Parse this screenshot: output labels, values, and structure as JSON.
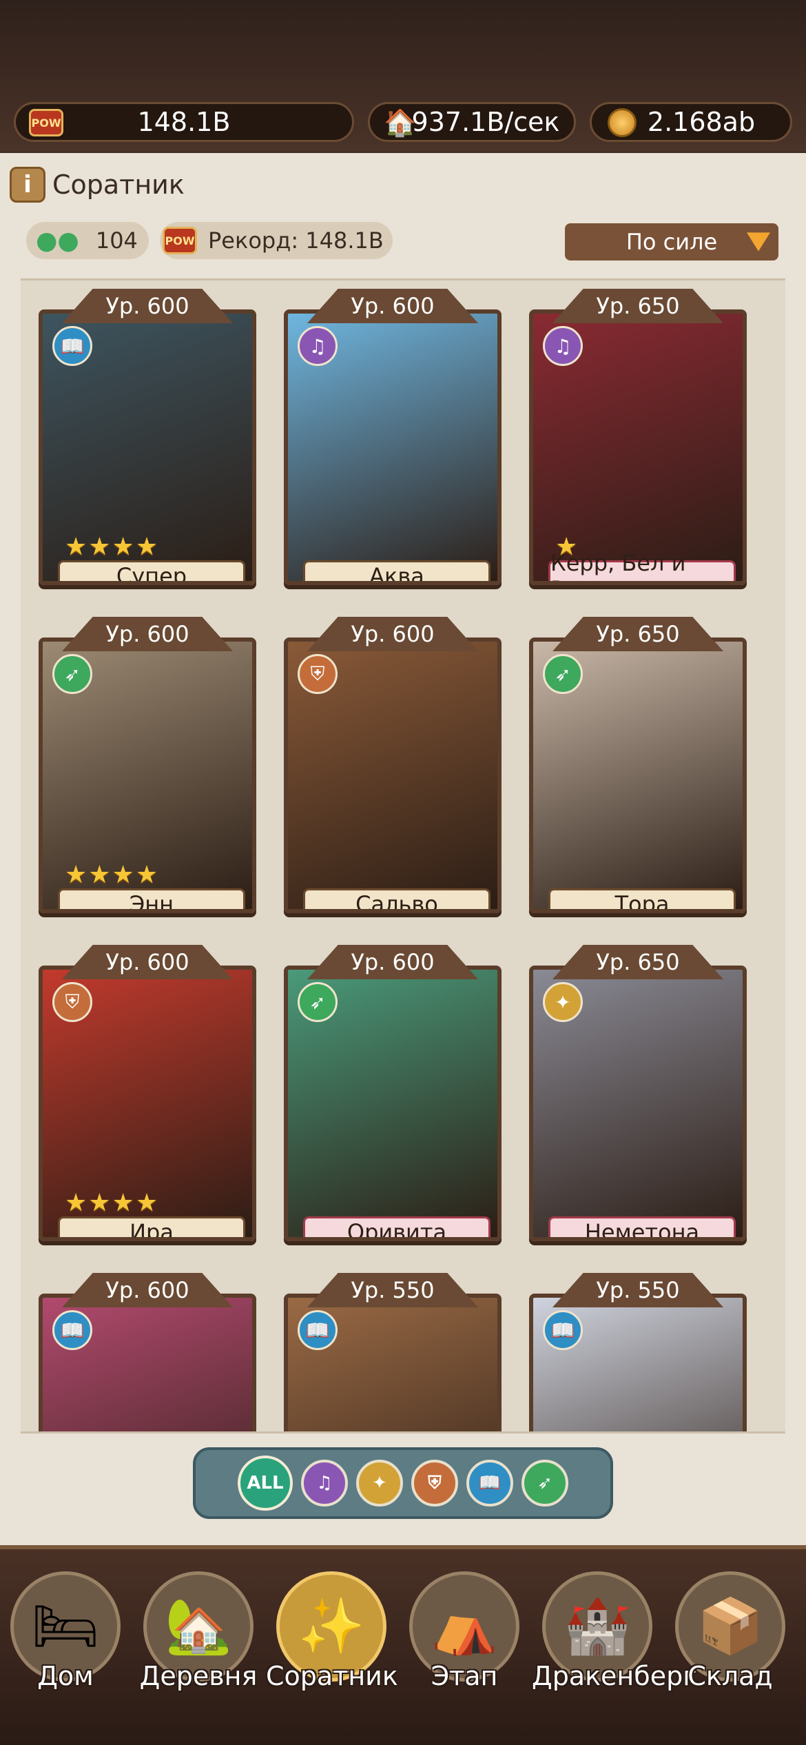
{
  "topbar": {
    "pow_icon": "POW",
    "power": "148.1B",
    "income": "937.1B/сек",
    "currency": "2.168ab"
  },
  "header": {
    "title": "Соратник"
  },
  "stats": {
    "count": "104",
    "pow_icon": "POW",
    "record": "Рекорд: 148.1B",
    "sort": "По силе"
  },
  "cards": [
    {
      "level": "Ур. 600",
      "name": "Супер",
      "stars": "★★★★",
      "role_icon": "book-icon",
      "role_color": "#2f8fc4",
      "art": "#3d5560",
      "name_style": "gold"
    },
    {
      "level": "Ур. 600",
      "name": "Аква",
      "stars": "",
      "role_icon": "lyre-icon",
      "role_color": "#8a56b3",
      "art": "#6fb6e0",
      "name_style": "gold"
    },
    {
      "level": "Ур. 650",
      "name": "Керр, Бел и Росс",
      "stars": "★",
      "role_icon": "lyre-icon",
      "role_color": "#8a56b3",
      "art": "#8a2a33",
      "name_style": "pink"
    },
    {
      "level": "Ур. 600",
      "name": "Энн",
      "stars": "★★★★",
      "role_icon": "wing-icon",
      "role_color": "#3ea85d",
      "art": "#9c8a73",
      "name_style": "gold"
    },
    {
      "level": "Ур. 600",
      "name": "Сальво",
      "stars": "",
      "role_icon": "shield-icon",
      "role_color": "#c46d3a",
      "art": "#8a5a38",
      "name_style": "gold"
    },
    {
      "level": "Ур. 650",
      "name": "Тора",
      "stars": "",
      "role_icon": "wing-icon",
      "role_color": "#3ea85d",
      "art": "#c9b8a8",
      "name_style": "gold"
    },
    {
      "level": "Ур. 600",
      "name": "Ира",
      "stars": "★★★★",
      "role_icon": "shield-icon",
      "role_color": "#c46d3a",
      "art": "#c23a2d",
      "name_style": "gold"
    },
    {
      "level": "Ур. 600",
      "name": "Оривита",
      "stars": "",
      "role_icon": "wing-icon",
      "role_color": "#3ea85d",
      "art": "#4a9a7a",
      "name_style": "pink"
    },
    {
      "level": "Ур. 650",
      "name": "Неметона",
      "stars": "",
      "role_icon": "broom-icon",
      "role_color": "#d3a236",
      "art": "#8a8a95",
      "name_style": "pink"
    },
    {
      "level": "Ур. 600",
      "name": "",
      "stars": "",
      "role_icon": "book-icon",
      "role_color": "#2f8fc4",
      "art": "#b24a6e",
      "name_style": "gold"
    },
    {
      "level": "Ур. 550",
      "name": "",
      "stars": "",
      "role_icon": "book-icon",
      "role_color": "#2f8fc4",
      "art": "#9a6a45",
      "name_style": "gold"
    },
    {
      "level": "Ур. 550",
      "name": "",
      "stars": "",
      "role_icon": "book-icon",
      "role_color": "#2f8fc4",
      "art": "#cfd3de",
      "name_style": "gold"
    }
  ],
  "filters": {
    "all": "ALL",
    "items": [
      {
        "icon": "lyre-icon",
        "color": "#8a56b3"
      },
      {
        "icon": "broom-icon",
        "color": "#d3a236"
      },
      {
        "icon": "shield-icon",
        "color": "#c46d3a"
      },
      {
        "icon": "book-icon",
        "color": "#2f8fc4"
      },
      {
        "icon": "wing-icon",
        "color": "#3ea85d"
      }
    ]
  },
  "nav": [
    {
      "label": "Дом",
      "icon": "bed-icon",
      "active": false
    },
    {
      "label": "Деревня",
      "icon": "windmill-icon",
      "active": false
    },
    {
      "label": "Соратник",
      "icon": "companion-icon",
      "active": true
    },
    {
      "label": "Этап",
      "icon": "tent-icon",
      "active": false
    },
    {
      "label": "Дракенберг",
      "icon": "castle-icon",
      "active": false
    },
    {
      "label": "Склад",
      "icon": "storage-icon",
      "active": false
    }
  ]
}
